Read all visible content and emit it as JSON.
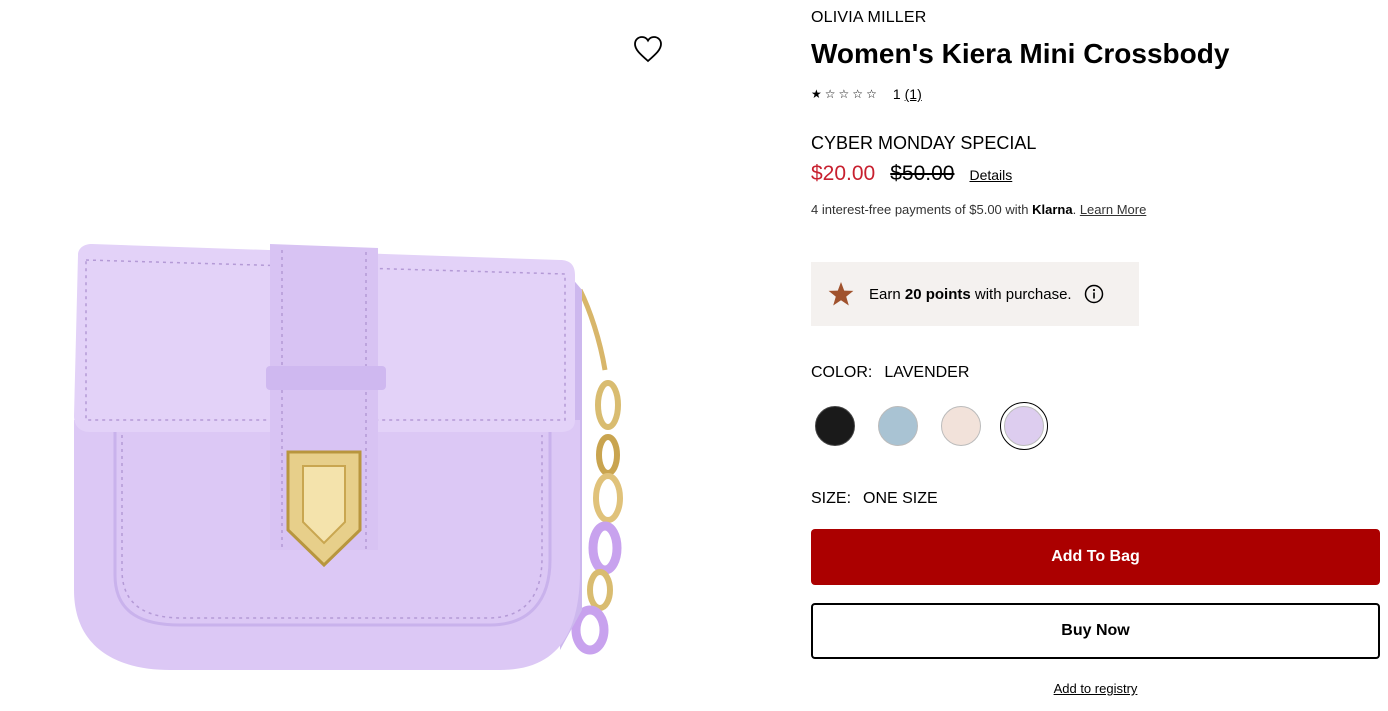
{
  "product": {
    "brand": "OLIVIA MILLER",
    "title": "Women's Kiera Mini Crossbody",
    "rating": {
      "stars_filled": 1,
      "stars_total": 5,
      "value": "1",
      "review_count": "(1)"
    },
    "promo_label": "CYBER MONDAY SPECIAL",
    "sale_price": "$20.00",
    "original_price": "$50.00",
    "details_link": "Details",
    "klarna": {
      "prefix": "4 interest-free payments of $5.00 with ",
      "brand": "Klarna",
      "suffix": ". ",
      "link": "Learn More"
    },
    "points": {
      "prefix": "Earn ",
      "amount": "20 points",
      "suffix": " with purchase."
    },
    "color": {
      "label": "COLOR:",
      "selected": "LAVENDER",
      "swatches": [
        {
          "name": "black",
          "hex": "#1a1a1a"
        },
        {
          "name": "light blue",
          "hex": "#a9c3d3"
        },
        {
          "name": "blush",
          "hex": "#f2e2da"
        },
        {
          "name": "lavender",
          "hex": "#ddcdef",
          "selected": true
        }
      ]
    },
    "size": {
      "label": "SIZE:",
      "value": "ONE SIZE"
    },
    "buttons": {
      "add_to_bag": "Add To Bag",
      "buy_now": "Buy Now",
      "add_to_registry": "Add to registry"
    },
    "colors": {
      "sale_red": "#c8202f",
      "add_to_bag_bg": "#ab0000",
      "points_bg": "#f4f1ef",
      "points_star": "#a0522d"
    },
    "icons": [
      "heart-icon",
      "star-icon",
      "info-icon"
    ]
  }
}
